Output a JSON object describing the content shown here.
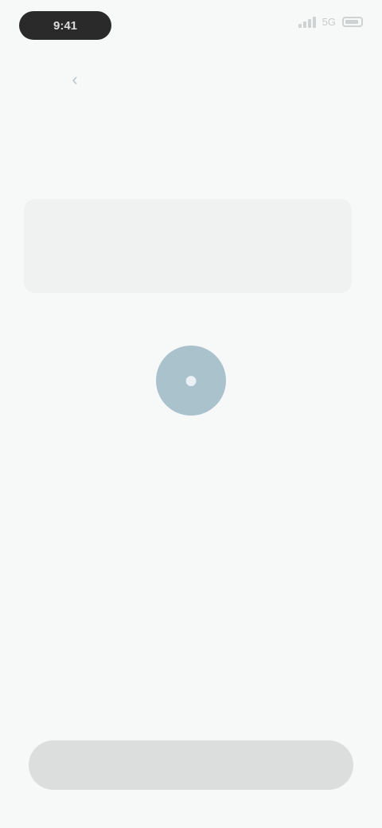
{
  "status_bar": {
    "time": "9:41",
    "network": "5G"
  },
  "nav": {
    "back_label": "",
    "label": ""
  },
  "header": {
    "title": "",
    "subtitle": ""
  },
  "card": {
    "title": "",
    "subtitle": ""
  },
  "divider": {
    "label": ""
  },
  "action": {
    "icon": "person-icon",
    "caption": "",
    "link": ""
  },
  "footer": {
    "button_label": ""
  },
  "colors": {
    "accent": "#a9c2cc",
    "background": "#f7f8f8",
    "card": "#f0f1f1",
    "button": "#dcdddd"
  }
}
